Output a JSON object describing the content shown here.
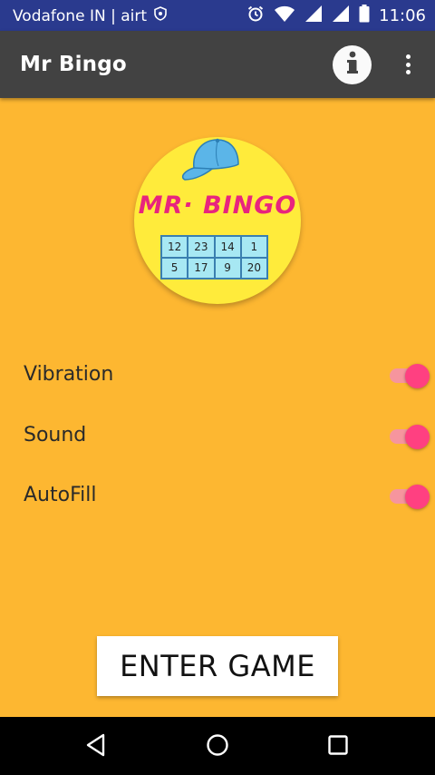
{
  "status_bar": {
    "carrier": "Vodafone IN | airt",
    "time": "11:06",
    "background": "#2a3a8e"
  },
  "app_bar": {
    "title": "Mr Bingo",
    "background": "#424242",
    "icons": [
      "info-icon",
      "overflow-menu-icon"
    ]
  },
  "logo": {
    "title": "MR· BINGO",
    "grid": [
      "12",
      "23",
      "14",
      "1",
      "5",
      "17",
      "9",
      "20"
    ],
    "icon": "cap-icon"
  },
  "settings": [
    {
      "label": "Vibration",
      "enabled": true
    },
    {
      "label": "Sound",
      "enabled": true
    },
    {
      "label": "AutoFill",
      "enabled": true
    }
  ],
  "enter_button": {
    "label": "ENTER GAME"
  },
  "nav_bar": {
    "icons": [
      "back-icon",
      "home-icon",
      "recents-icon"
    ]
  },
  "colors": {
    "background": "#FDB731",
    "accent": "#FF4081",
    "logo_circle": "#FFEB3B",
    "logo_text": "#E8247E"
  }
}
